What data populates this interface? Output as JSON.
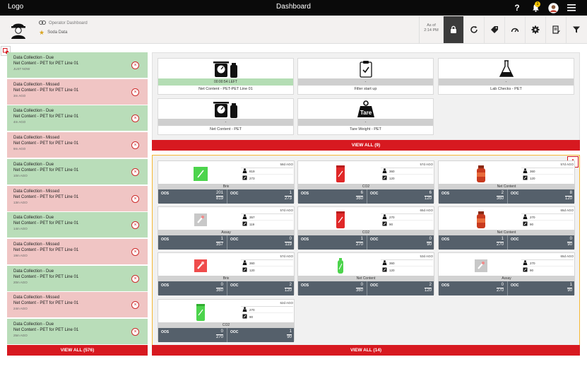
{
  "topbar": {
    "logo": "Logo",
    "title": "Dashboard",
    "notif_count": "1"
  },
  "header": {
    "breadcrumb": "Operator Dashboard",
    "subtitle": "Soda Data",
    "as_of_label": "As of",
    "as_of_time": "2:14 PM"
  },
  "notifications": [
    {
      "title": "Data Collection - Due",
      "detail": "Net Content - PET for PET Line 01",
      "time": "JUST NOW",
      "status": "due"
    },
    {
      "title": "Data Collection - Missed",
      "detail": "Net Content - PET for PET Line 01",
      "time": "3m AGO",
      "status": "missed"
    },
    {
      "title": "Data Collection - Due",
      "detail": "Net Content - PET for PET Line 01",
      "time": "4m AGO",
      "status": "due"
    },
    {
      "title": "Data Collection - Missed",
      "detail": "Net Content - PET for PET Line 01",
      "time": "9m AGO",
      "status": "missed"
    },
    {
      "title": "Data Collection - Due",
      "detail": "Net Content - PET for PET Line 01",
      "time": "10m AGO",
      "status": "due"
    },
    {
      "title": "Data Collection - Missed",
      "detail": "Net Content - PET for PET Line 01",
      "time": "13m AGO",
      "status": "missed"
    },
    {
      "title": "Data Collection - Due",
      "detail": "Net Content - PET for PET Line 01",
      "time": "14m AGO",
      "status": "due"
    },
    {
      "title": "Data Collection - Missed",
      "detail": "Net Content - PET for PET Line 01",
      "time": "19m AGO",
      "status": "missed"
    },
    {
      "title": "Data Collection - Due",
      "detail": "Net Content - PET for PET Line 01",
      "time": "20m AGO",
      "status": "due"
    },
    {
      "title": "Data Collection - Missed",
      "detail": "Net Content - PET for PET Line 01",
      "time": "24m AGO",
      "status": "missed"
    },
    {
      "title": "Data Collection - Due",
      "detail": "Net Content - PET for PET Line 01",
      "time": "25m AGO",
      "status": "due"
    }
  ],
  "notifications_view_all": "VIEW ALL  (576)",
  "tasks": [
    {
      "label": "Net Content - PET-PET Line 01",
      "status": "00:00:54 LEFT",
      "icon": "scale-bottle-icon",
      "status_color": "green"
    },
    {
      "label": "Filler start up",
      "status": "-",
      "icon": "clipboard-check-icon",
      "status_color": "gray"
    },
    {
      "label": "Lab Checks - PET",
      "status": "-",
      "icon": "flask-icon",
      "status_color": "gray"
    },
    {
      "label": "Net Content - PET",
      "status": "-",
      "icon": "scale-bottle-icon",
      "status_color": "gray"
    },
    {
      "label": "Tare Weight - PET",
      "status": "-",
      "icon": "tare-weight-icon",
      "status_color": "gray"
    }
  ],
  "tasks_view_all": "VIEW ALL (9)",
  "checks": [
    {
      "name": "Brix",
      "time": "58d AGO",
      "m1": "819",
      "m2": "273",
      "oos_num": "201",
      "oos_den": "819",
      "ooc_num": "1",
      "ooc_den": "273",
      "pic": "green-bottle-icon"
    },
    {
      "name": "CO2",
      "time": "57d AGO",
      "m1": "360",
      "m2": "120",
      "oos_num": "6",
      "oos_den": "360",
      "ooc_num": "6",
      "ooc_den": "120",
      "pic": "red-can-icon"
    },
    {
      "name": "Net Content",
      "time": "57d AGO",
      "m1": "360",
      "m2": "120",
      "oos_num": "2",
      "oos_den": "360",
      "ooc_num": "8",
      "ooc_den": "120",
      "pic": "red-jar-icon"
    },
    {
      "name": "Assay",
      "time": "57d AGO",
      "m1": "357",
      "m2": "119",
      "oos_num": "1",
      "oos_den": "357",
      "ooc_num": "0",
      "ooc_den": "119",
      "pic": "gray-vial-icon"
    },
    {
      "name": "CO2",
      "time": "65d AGO",
      "m1": "270",
      "m2": "90",
      "oos_num": "1",
      "oos_den": "270",
      "ooc_num": "0",
      "ooc_den": "90",
      "pic": "red-can-icon"
    },
    {
      "name": "Net Content",
      "time": "65d AGO",
      "m1": "270",
      "m2": "90",
      "oos_num": "1",
      "oos_den": "270",
      "ooc_num": "0",
      "ooc_den": "90",
      "pic": "red-jar-icon"
    },
    {
      "name": "Brix",
      "time": "57d AGO",
      "m1": "360",
      "m2": "120",
      "oos_num": "0",
      "oos_den": "360",
      "ooc_num": "2",
      "ooc_den": "120",
      "pic": "red-vial-icon"
    },
    {
      "name": "Net Content",
      "time": "53d AGO",
      "m1": "360",
      "m2": "120",
      "oos_num": "0",
      "oos_den": "360",
      "ooc_num": "2",
      "ooc_den": "120",
      "pic": "green-bottle-small-icon"
    },
    {
      "name": "Assay",
      "time": "65d AGO",
      "m1": "270",
      "m2": "90",
      "oos_num": "0",
      "oos_den": "270",
      "ooc_num": "1",
      "ooc_den": "90",
      "pic": "gray-vial-icon"
    },
    {
      "name": "CO2",
      "time": "62d AGO",
      "m1": "270",
      "m2": "90",
      "oos_num": "0",
      "oos_den": "270",
      "ooc_num": "1",
      "ooc_den": "90",
      "pic": "green-can-icon"
    }
  ],
  "check_labels": {
    "oos": "OOS",
    "ooc": "OOC"
  },
  "checks_view_all": "VIEW ALL (14)",
  "colors": {
    "accent_red": "#d71920",
    "due_green": "#b9ddb9",
    "missed_red": "#f0c5c4",
    "stats_slate": "#55606b",
    "highlight_border": "#f5b733"
  }
}
